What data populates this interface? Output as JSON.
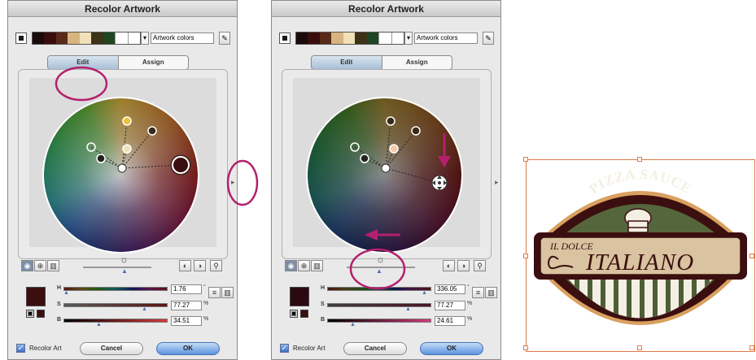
{
  "dialogs": [
    {
      "title": "Recolor Artwork",
      "color_group_field": "Artwork colors",
      "tabs": [
        "Edit",
        "Assign"
      ],
      "active_tab": "Edit",
      "hsb": {
        "h_label": "H",
        "s_label": "S",
        "b_label": "B",
        "h": "1.76",
        "s": "77.27",
        "b": "34.51",
        "h_unit": "°",
        "s_unit": "%",
        "b_unit": "%"
      },
      "recolor_art_label": "Recolor Art",
      "recolor_art_checked": true,
      "cancel_label": "Cancel",
      "ok_label": "OK",
      "swatches": [
        "#1a0a0a",
        "#3a0d0d",
        "#5a2a18",
        "#d8b480",
        "#f2e0b8",
        "#3c3218",
        "#1e4622",
        "#ffffff",
        "#ffffff"
      ],
      "selected_color": "#4a1414"
    },
    {
      "title": "Recolor Artwork",
      "color_group_field": "Artwork colors",
      "tabs": [
        "Edit",
        "Assign"
      ],
      "active_tab": "Edit",
      "hsb": {
        "h_label": "H",
        "s_label": "S",
        "b_label": "B",
        "h": "336.05",
        "s": "77.27",
        "b": "24.61",
        "h_unit": "°",
        "s_unit": "%",
        "b_unit": "%"
      },
      "recolor_art_label": "Recolor Art",
      "recolor_art_checked": true,
      "cancel_label": "Cancel",
      "ok_label": "OK",
      "swatches": [
        "#1a0a0a",
        "#3a0d0d",
        "#5a2a18",
        "#d8b480",
        "#f2e0b8",
        "#3c3218",
        "#1e4622",
        "#ffffff",
        "#ffffff"
      ],
      "selected_color": "#3a0d14"
    }
  ],
  "artwork": {
    "top_text": "PIZZA SAUCE",
    "small_text": "IL DOLCE",
    "big_text": "ITALIANO",
    "colors": {
      "outer": "#3b0f0f",
      "green": "#56663c",
      "cream": "#d9c3a0",
      "stripe": "#f3efe2",
      "stripe_green": "#4d5d36"
    }
  },
  "annotation_color": "#b3206e"
}
